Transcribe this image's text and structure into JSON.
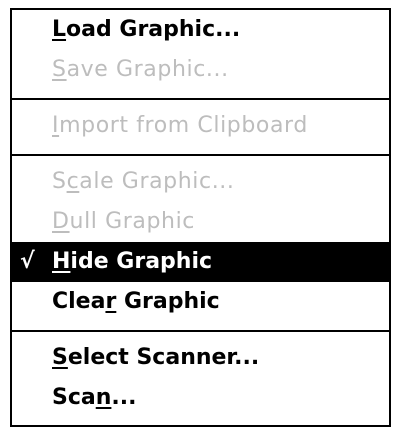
{
  "menu": {
    "groups": [
      [
        {
          "pre": "",
          "key": "L",
          "post": "oad Graphic...",
          "enabled": true,
          "checked": false
        },
        {
          "pre": "",
          "key": "S",
          "post": "ave Graphic...",
          "enabled": false,
          "checked": false
        }
      ],
      [
        {
          "pre": "",
          "key": "I",
          "post": "mport from Clipboard",
          "enabled": false,
          "checked": false
        }
      ],
      [
        {
          "pre": "S",
          "key": "c",
          "post": "ale Graphic...",
          "enabled": false,
          "checked": false
        },
        {
          "pre": "",
          "key": "D",
          "post": "ull Graphic",
          "enabled": false,
          "checked": false
        },
        {
          "pre": "",
          "key": "H",
          "post": "ide Graphic",
          "enabled": true,
          "checked": true,
          "selected": true
        },
        {
          "pre": "Clea",
          "key": "r",
          "post": " Graphic",
          "enabled": true,
          "checked": false
        }
      ],
      [
        {
          "pre": "",
          "key": "S",
          "post": "elect Scanner...",
          "enabled": true,
          "checked": false
        },
        {
          "pre": "Sca",
          "key": "n",
          "post": "...",
          "enabled": true,
          "checked": false
        }
      ]
    ],
    "check_glyph": "√"
  }
}
